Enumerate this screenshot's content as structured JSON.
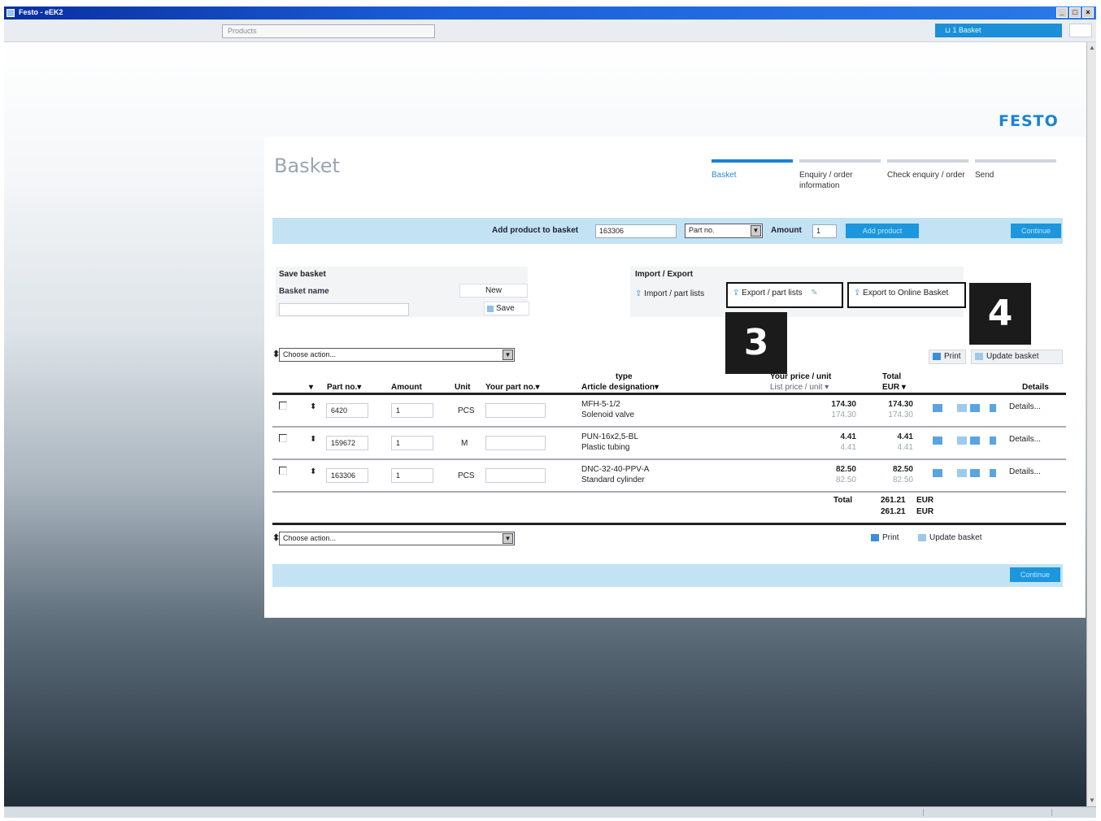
{
  "window": {
    "title": "Festo - eEK2"
  },
  "toolbar": {
    "products_placeholder": "Products",
    "basket_label": "1 Basket"
  },
  "brand": {
    "logo": "FESTO",
    "accent": "#1a83d4"
  },
  "page": {
    "title": "Basket"
  },
  "steps": [
    {
      "label": "Basket",
      "active": true
    },
    {
      "label": "Enquiry / order information",
      "active": false
    },
    {
      "label": "Check enquiry / order",
      "active": false
    },
    {
      "label": "Send",
      "active": false
    }
  ],
  "add_bar": {
    "label": "Add product to basket",
    "product_value": "163306",
    "type_select": "Part no.",
    "amount_label": "Amount",
    "amount_value": "1",
    "add_button": "Add product",
    "continue_button": "Continue"
  },
  "save_basket": {
    "heading": "Save basket",
    "name_label": "Basket name",
    "new_button": "New",
    "save_button": "Save"
  },
  "import_export": {
    "heading": "Import / Export",
    "import_label": "Import / part lists",
    "export_label": "Export / part lists",
    "export_online_label": "Export to Online Basket"
  },
  "markers": {
    "m3": "3",
    "m4": "4"
  },
  "actions": {
    "choose_action": "Choose action...",
    "print": "Print",
    "update": "Update basket"
  },
  "table": {
    "headers": {
      "part_no": "Part no.▾",
      "amount": "Amount",
      "unit": "Unit",
      "your_part_no": "Your part no.▾",
      "type": "type",
      "designation": "Article designation▾",
      "price": "Your price / unit",
      "list_price": "List price / unit ▾",
      "total": "Total",
      "total_cur": "EUR ▾",
      "details": "Details"
    },
    "rows": [
      {
        "part_no": "6420",
        "amount": "1",
        "unit": "PCS",
        "type": "MFH-5-1/2",
        "designation": "Solenoid valve",
        "price": "174.30",
        "list_price": "174.30",
        "total": "174.30",
        "total_list": "174.30",
        "details": "Details..."
      },
      {
        "part_no": "159672",
        "amount": "1",
        "unit": "M",
        "type": "PUN-16x2,5-BL",
        "designation": "Plastic tubing",
        "price": "4.41",
        "list_price": "4.41",
        "total": "4.41",
        "total_list": "4.41",
        "details": "Details..."
      },
      {
        "part_no": "163306",
        "amount": "1",
        "unit": "PCS",
        "type": "DNC-32-40-PPV-A",
        "designation": "Standard cylinder",
        "price": "82.50",
        "list_price": "82.50",
        "total": "82.50",
        "total_list": "82.50",
        "details": "Details..."
      }
    ],
    "total_label": "Total",
    "total_value": "261.21",
    "total_list_value": "261.21",
    "currency": "EUR"
  },
  "bottom_bar": {
    "continue_button": "Continue"
  }
}
